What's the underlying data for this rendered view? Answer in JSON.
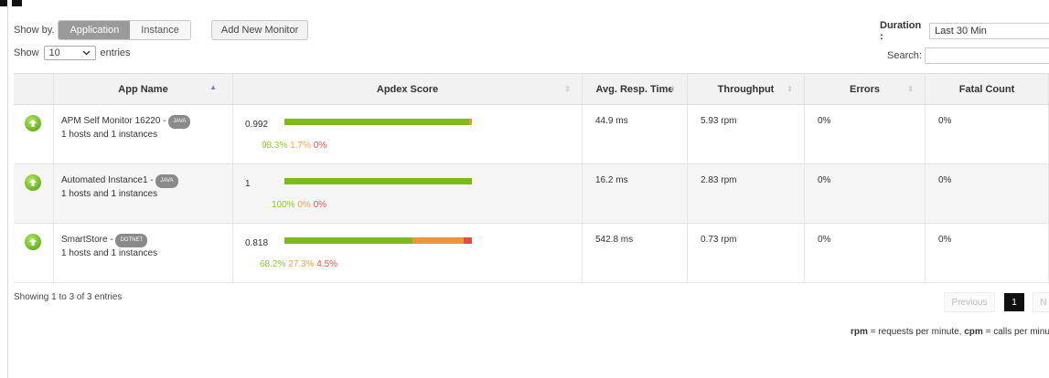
{
  "controls": {
    "show_by_label": "Show by.",
    "view_options": [
      "Application",
      "Instance"
    ],
    "add_monitor_label": "Add New Monitor",
    "show_label": "Show",
    "entries_value": "10",
    "entries_label": "entries",
    "duration_label": "Duration :",
    "duration_value": "Last 30 Min",
    "search_label": "Search:"
  },
  "table": {
    "columns": [
      "App Name",
      "Apdex Score",
      "Avg. Resp. Time",
      "Throughput",
      "Errors",
      "Fatal Count"
    ],
    "rows": [
      {
        "name": "APM Self Monitor 16220 - ",
        "badge": "JAVA",
        "sub": "1 hosts and 1 instances",
        "score": "0.992",
        "satisfied": 98.3,
        "tolerating": 1.7,
        "frustrated": 0,
        "p_satisfied": "98.3%",
        "p_tolerating": "1.7%",
        "p_frustrated": "0%",
        "resp": "44.9 ms",
        "throughput": "5.93 rpm",
        "errors": "0%",
        "fatal": "0%"
      },
      {
        "name": "Automated Instance1 - ",
        "badge": "JAVA",
        "sub": "1 hosts and 1 instances",
        "score": "1",
        "satisfied": 100,
        "tolerating": 0,
        "frustrated": 0,
        "p_satisfied": "100%",
        "p_tolerating": "0%",
        "p_frustrated": "0%",
        "resp": "16.2 ms",
        "throughput": "2.83 rpm",
        "errors": "0%",
        "fatal": "0%"
      },
      {
        "name": "SmartStore - ",
        "badge": "DOTNET",
        "sub": "1 hosts and 1 instances",
        "score": "0.818",
        "satisfied": 68.2,
        "tolerating": 27.3,
        "frustrated": 4.5,
        "p_satisfied": "68.2%",
        "p_tolerating": "27.3%",
        "p_frustrated": "4.5%",
        "resp": "542.8 ms",
        "throughput": "0.73 rpm",
        "errors": "0%",
        "fatal": "0%"
      }
    ]
  },
  "footer": {
    "showing": "Showing 1 to 3 of 3 entries",
    "previous": "Previous",
    "page": "1",
    "next": "N",
    "legend_rpm": "rpm",
    "legend_rpm_text": " = requests per minute, ",
    "legend_cpm": "cpm",
    "legend_cpm_text": " = calls per minute"
  },
  "colors": {
    "satisfied": "#7dbb1a",
    "tolerating": "#f1943a",
    "frustrated": "#e24c42",
    "status_up": "#6ab21f"
  }
}
